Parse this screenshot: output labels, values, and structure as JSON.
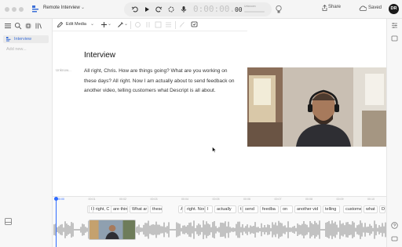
{
  "window": {
    "title": "Remote Interview",
    "share_label": "Share",
    "saved_label": "Saved",
    "avatar_initials": "DR"
  },
  "transport": {
    "timecode_main": "0:00:00.",
    "timecode_frames": "00",
    "unknown_label": "Unknown"
  },
  "sidebar": {
    "items": [
      {
        "label": "Interview"
      }
    ],
    "add_label": "Add new..."
  },
  "toolbar": {
    "edit_media_label": "Edit Media"
  },
  "script": {
    "title": "Interview",
    "speaker": "Unknow...",
    "text": "All right, Chris. How are things going? What are you working on these days? All right. Now I am actually about to send feedback on another video, telling  customers what Descript is all about."
  },
  "timeline": {
    "ruler_ticks": [
      "00:00",
      "00:01",
      "00:02",
      "00:03",
      "00:04",
      "00:05",
      "00:06",
      "00:07",
      "00:08",
      "00:09",
      "00:10"
    ],
    "words": [
      "All right, C",
      "II",
      "are thing",
      "What ar",
      "these",
      "A",
      "right. Nov",
      "I",
      "actually",
      "t",
      "send",
      "feedba",
      "on",
      "another vid",
      "telling",
      "custome",
      "what",
      "D"
    ]
  },
  "colors": {
    "accent": "#2f6bff",
    "link": "#3b6fd8"
  }
}
